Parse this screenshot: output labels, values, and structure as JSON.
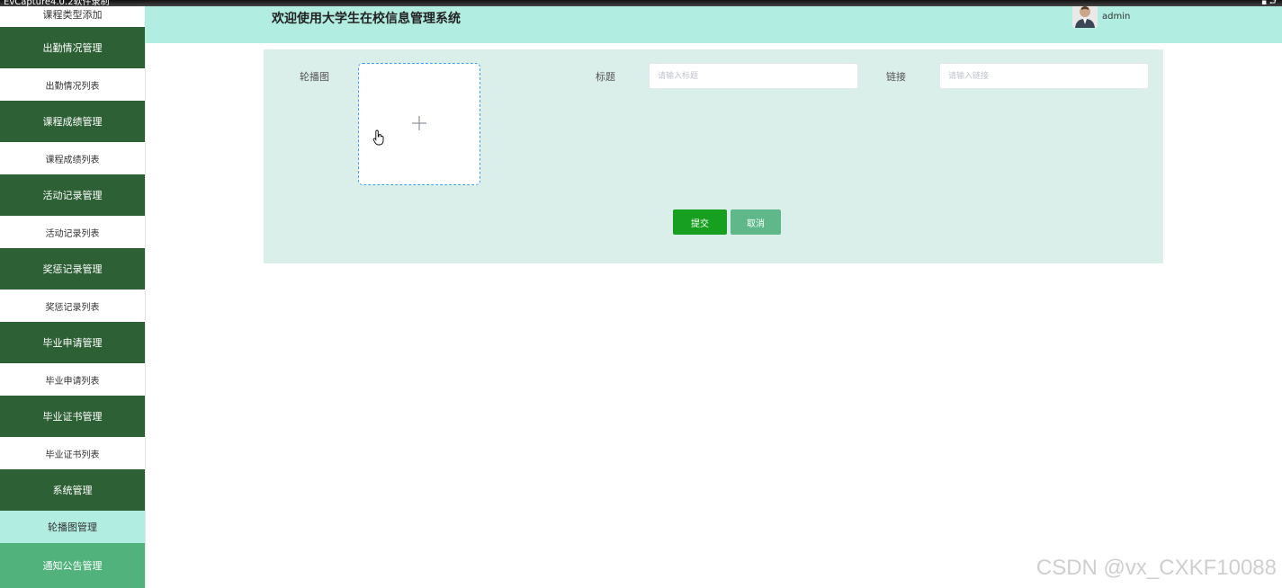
{
  "recorder": {
    "title": "EvCapture4.0.2软件录制",
    "controls": "▪ ⮐"
  },
  "header": {
    "title": "欢迎使用大学生在校信息管理系统",
    "username": "admin"
  },
  "sidebar": {
    "partial_top": "课程类型添加",
    "items": [
      {
        "label": "出勤情况管理",
        "type": "group"
      },
      {
        "label": "出勤情况列表",
        "type": "sub"
      },
      {
        "label": "课程成绩管理",
        "type": "group"
      },
      {
        "label": "课程成绩列表",
        "type": "sub"
      },
      {
        "label": "活动记录管理",
        "type": "group"
      },
      {
        "label": "活动记录列表",
        "type": "sub"
      },
      {
        "label": "奖惩记录管理",
        "type": "group"
      },
      {
        "label": "奖惩记录列表",
        "type": "sub"
      },
      {
        "label": "毕业申请管理",
        "type": "group"
      },
      {
        "label": "毕业申请列表",
        "type": "sub"
      },
      {
        "label": "毕业证书管理",
        "type": "group"
      },
      {
        "label": "毕业证书列表",
        "type": "sub"
      },
      {
        "label": "系统管理",
        "type": "group"
      },
      {
        "label": "轮播图管理",
        "type": "sub-active"
      },
      {
        "label": "通知公告管理",
        "type": "group-light"
      }
    ]
  },
  "form": {
    "image_label": "轮播图",
    "title_label": "标题",
    "title_placeholder": "请输入标题",
    "title_value": "",
    "link_label": "链接",
    "link_placeholder": "请输入链接",
    "link_value": "",
    "submit_label": "提交",
    "cancel_label": "取消"
  },
  "watermark": "CSDN @vx_CXKF10088",
  "colors": {
    "sidebar_group": "#2e6035",
    "sidebar_active": "#b2ede2",
    "header_bg": "#b2ede2",
    "panel_bg": "#daeeea",
    "submit": "#17a01f",
    "cancel": "#5fb88a"
  },
  "icons": {
    "upload": "plus-icon",
    "cursor": "hand-cursor-icon",
    "avatar": "user-avatar"
  }
}
